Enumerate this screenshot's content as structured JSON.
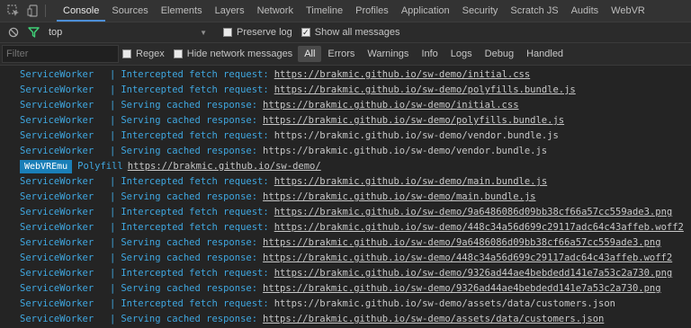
{
  "tabs": [
    {
      "label": "Console",
      "active": true
    },
    {
      "label": "Sources"
    },
    {
      "label": "Elements"
    },
    {
      "label": "Layers"
    },
    {
      "label": "Network"
    },
    {
      "label": "Timeline"
    },
    {
      "label": "Profiles"
    },
    {
      "label": "Application"
    },
    {
      "label": "Security"
    },
    {
      "label": "Scratch JS"
    },
    {
      "label": "Audits"
    },
    {
      "label": "WebVR"
    }
  ],
  "toolbar": {
    "context": "top",
    "preserve_log": "Preserve log",
    "show_all": "Show all messages"
  },
  "filter": {
    "placeholder": "Filter",
    "regex": "Regex",
    "hide_network": "Hide network messages",
    "levels": [
      "All",
      "Errors",
      "Warnings",
      "Info",
      "Logs",
      "Debug",
      "Handled"
    ]
  },
  "colors": {
    "accent": "#3fa7e0",
    "badge": "#1a7fb8"
  },
  "log": [
    {
      "src": "ServiceWorker",
      "msg": "Intercepted fetch request:",
      "url": "https://brakmic.github.io/sw-demo/initial.css",
      "link": true
    },
    {
      "src": "ServiceWorker",
      "msg": "Intercepted fetch request:",
      "url": "https://brakmic.github.io/sw-demo/polyfills.bundle.js",
      "link": true
    },
    {
      "src": "ServiceWorker",
      "msg": "Serving cached response:",
      "url": "https://brakmic.github.io/sw-demo/initial.css",
      "link": true
    },
    {
      "src": "ServiceWorker",
      "msg": "Serving cached response:",
      "url": "https://brakmic.github.io/sw-demo/polyfills.bundle.js",
      "link": true
    },
    {
      "src": "ServiceWorker",
      "msg": "Intercepted fetch request:",
      "url": "https://brakmic.github.io/sw-demo/vendor.bundle.js",
      "link": false
    },
    {
      "src": "ServiceWorker",
      "msg": "Serving cached response:",
      "url": "https://brakmic.github.io/sw-demo/vendor.bundle.js",
      "link": false
    },
    {
      "badge": "WebVREmu",
      "msg": "Polyfill",
      "url": "https://brakmic.github.io/sw-demo/",
      "link": true
    },
    {
      "src": "ServiceWorker",
      "msg": "Intercepted fetch request:",
      "url": "https://brakmic.github.io/sw-demo/main.bundle.js",
      "link": true
    },
    {
      "src": "ServiceWorker",
      "msg": "Serving cached response:",
      "url": "https://brakmic.github.io/sw-demo/main.bundle.js",
      "link": true
    },
    {
      "src": "ServiceWorker",
      "msg": "Intercepted fetch request:",
      "url": "https://brakmic.github.io/sw-demo/9a6486086d09bb38cf66a57cc559ade3.png",
      "link": true
    },
    {
      "src": "ServiceWorker",
      "msg": "Intercepted fetch request:",
      "url": "https://brakmic.github.io/sw-demo/448c34a56d699c29117adc64c43affeb.woff2",
      "link": true
    },
    {
      "src": "ServiceWorker",
      "msg": "Serving cached response:",
      "url": "https://brakmic.github.io/sw-demo/9a6486086d09bb38cf66a57cc559ade3.png",
      "link": true
    },
    {
      "src": "ServiceWorker",
      "msg": "Serving cached response:",
      "url": "https://brakmic.github.io/sw-demo/448c34a56d699c29117adc64c43affeb.woff2",
      "link": true
    },
    {
      "src": "ServiceWorker",
      "msg": "Intercepted fetch request:",
      "url": "https://brakmic.github.io/sw-demo/9326ad44ae4bebdedd141e7a53c2a730.png",
      "link": true
    },
    {
      "src": "ServiceWorker",
      "msg": "Serving cached response:",
      "url": "https://brakmic.github.io/sw-demo/9326ad44ae4bebdedd141e7a53c2a730.png",
      "link": true
    },
    {
      "src": "ServiceWorker",
      "msg": "Intercepted fetch request:",
      "url": "https://brakmic.github.io/sw-demo/assets/data/customers.json",
      "link": false
    },
    {
      "src": "ServiceWorker",
      "msg": "Serving cached response:",
      "url": "https://brakmic.github.io/sw-demo/assets/data/customers.json",
      "link": true
    }
  ]
}
